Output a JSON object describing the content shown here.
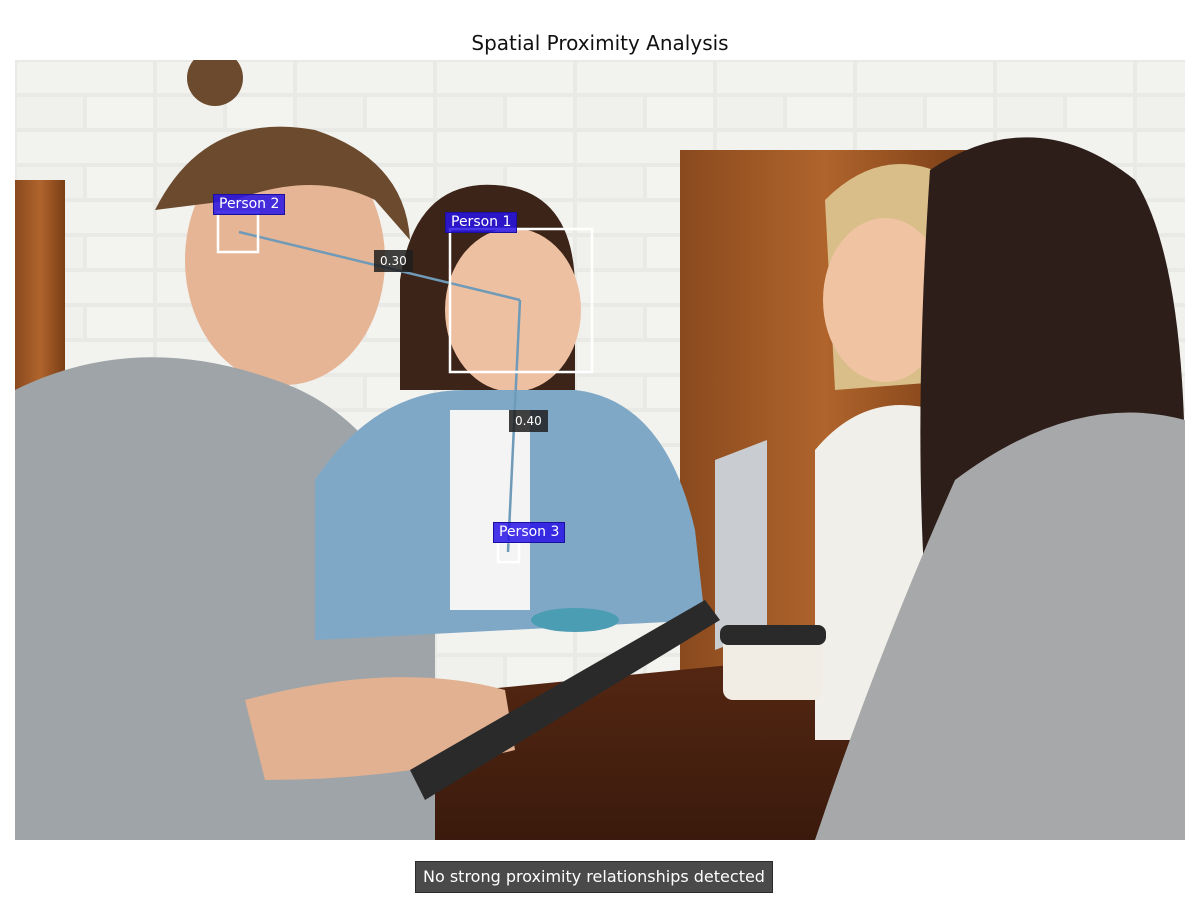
{
  "title": "Spatial Proximity Analysis",
  "status_message": "No strong proximity relationships detected",
  "people": [
    {
      "label": "Person 1"
    },
    {
      "label": "Person 2"
    },
    {
      "label": "Person 3"
    }
  ],
  "connections": [
    {
      "from": "Person 2",
      "to": "Person 1",
      "distance": "0.30"
    },
    {
      "from": "Person 1",
      "to": "Person 3",
      "distance": "0.40"
    }
  ],
  "colors": {
    "label_background": "#2814e6",
    "box_outline": "#ffffff",
    "connection_line": "#6f9ab8",
    "distance_label_background": "#1e1e1e",
    "status_background": "#4a4a4a"
  }
}
